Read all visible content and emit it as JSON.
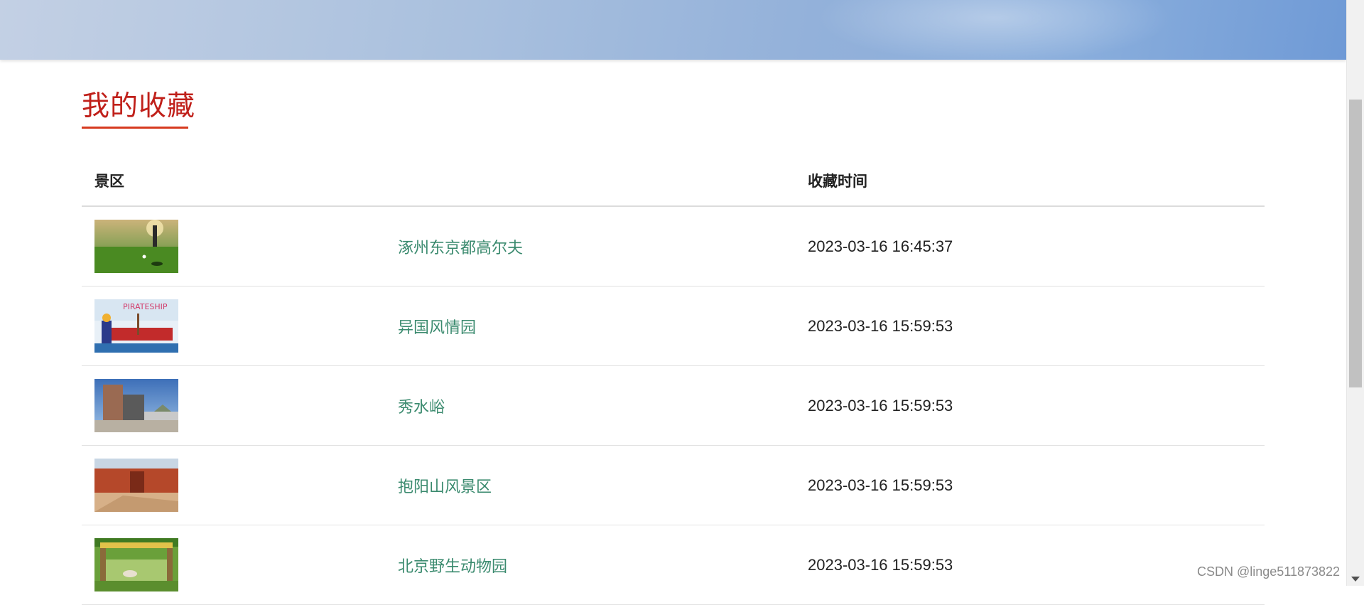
{
  "page": {
    "title": "我的收藏"
  },
  "table": {
    "headers": {
      "scenic": "景区",
      "time": "收藏时间"
    },
    "rows": [
      {
        "thumb_icon": "golf-course-photo",
        "name": "涿州东京都高尔夫",
        "time": "2023-03-16 16:45:37"
      },
      {
        "thumb_icon": "pirate-ship-ride-photo",
        "name": "异国风情园",
        "time": "2023-03-16 15:59:53"
      },
      {
        "thumb_icon": "stone-monument-photo",
        "name": "秀水峪",
        "time": "2023-03-16 15:59:53"
      },
      {
        "thumb_icon": "red-gate-wall-photo",
        "name": "抱阳山风景区",
        "time": "2023-03-16 15:59:53"
      },
      {
        "thumb_icon": "wildlife-park-gate-photo",
        "name": "北京野生动物园",
        "time": "2023-03-16 15:59:53"
      }
    ]
  },
  "watermark": "CSDN @linge511873822"
}
